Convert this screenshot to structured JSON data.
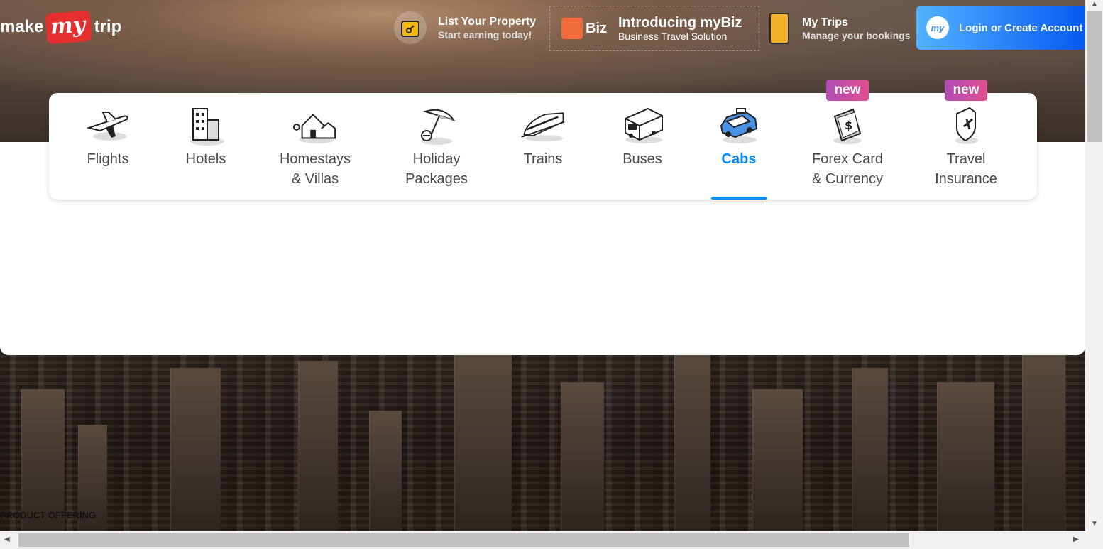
{
  "header": {
    "logo": {
      "make": "make",
      "my": "my",
      "trip": "trip"
    },
    "list_property": {
      "title": "List Your Property",
      "subtitle": "Start earning today!"
    },
    "mybiz": {
      "badge": "Biz",
      "title": "Introducing myBiz",
      "subtitle": "Business Travel Solution"
    },
    "my_trips": {
      "title": "My Trips",
      "subtitle": "Manage your bookings"
    },
    "login": {
      "avatar": "my",
      "label": "Login or Create Account"
    }
  },
  "nav": {
    "items": [
      {
        "line1": "Flights",
        "line2": "",
        "icon": "plane-icon"
      },
      {
        "line1": "Hotels",
        "line2": "",
        "icon": "hotel-icon"
      },
      {
        "line1": "Homestays",
        "line2": "& Villas",
        "icon": "house-icon"
      },
      {
        "line1": "Holiday",
        "line2": "Packages",
        "icon": "umbrella-icon"
      },
      {
        "line1": "Trains",
        "line2": "",
        "icon": "train-icon"
      },
      {
        "line1": "Buses",
        "line2": "",
        "icon": "bus-icon"
      },
      {
        "line1": "Cabs",
        "line2": "",
        "icon": "cab-icon",
        "active": true
      },
      {
        "line1": "Forex Card",
        "line2": "& Currency",
        "icon": "forex-icon",
        "badge": "new"
      },
      {
        "line1": "Travel",
        "line2": "Insurance",
        "icon": "insurance-icon",
        "badge": "new"
      }
    ]
  },
  "footer_label": "PRODUCT OFFERING",
  "colors": {
    "accent": "#008cff",
    "badge": "#c353a5",
    "logo_red": "#e52e2e"
  }
}
